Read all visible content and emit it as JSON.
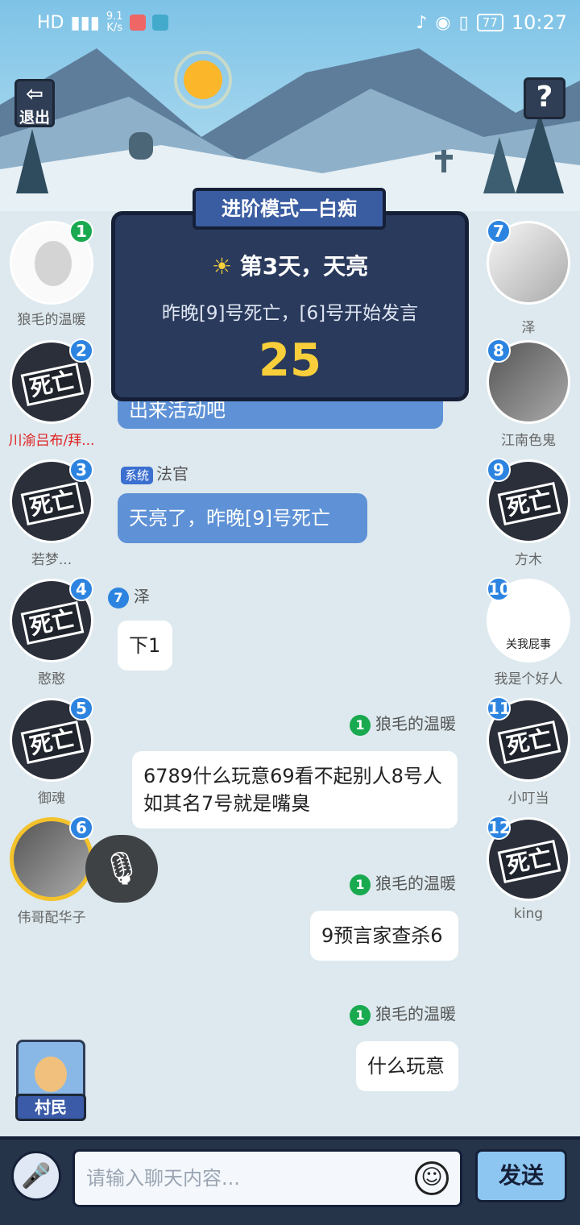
{
  "status_bar": {
    "time": "10:27",
    "battery": "77",
    "signal_label": "HD",
    "net_speed": "9.1",
    "net_unit": "K/s"
  },
  "top": {
    "exit_label": "退出",
    "help_label": "?"
  },
  "banner": {
    "title": "进阶模式—白痴",
    "day": "第3天，天亮",
    "message": "昨晚[9]号死亡，[6]号开始发言",
    "countdown": "25"
  },
  "players_left": [
    {
      "num": "1",
      "name": "狼毛的温暖",
      "dead": false
    },
    {
      "num": "2",
      "name": "川渝吕布/拜...",
      "dead": true
    },
    {
      "num": "3",
      "name": "若梦...",
      "dead": true
    },
    {
      "num": "4",
      "name": "憨憨",
      "dead": true
    },
    {
      "num": "5",
      "name": "御魂",
      "dead": true
    },
    {
      "num": "6",
      "name": "伟哥配华子",
      "dead": false
    }
  ],
  "players_right": [
    {
      "num": "7",
      "name": "泽",
      "dead": false
    },
    {
      "num": "8",
      "name": "江南色鬼",
      "dead": false
    },
    {
      "num": "9",
      "name": "方木",
      "dead": true
    },
    {
      "num": "10",
      "name": "我是个好人",
      "dead": false
    },
    {
      "num": "11",
      "name": "小叮当",
      "dead": true
    },
    {
      "num": "12",
      "name": "king",
      "dead": true
    }
  ],
  "dead_label": "死亡",
  "avatar10_text": "关我屁事",
  "messages": {
    "partial": "出来活动吧",
    "sys_tag": "系统",
    "sys_sender": "法官",
    "sys_text": "天亮了，昨晚[9]号死亡",
    "m1_num": "7",
    "m1_sender": "泽",
    "m1_text": "下1",
    "m2_num": "1",
    "m2_sender": "狼毛的温暖",
    "m2_text": "6789什么玩意69看不起别人8号人如其名7号就是嘴臭",
    "m3_num": "1",
    "m3_sender": "狼毛的温暖",
    "m3_text": "9预言家查杀6",
    "m4_num": "1",
    "m4_sender": "狼毛的温暖",
    "m4_text": "什么玩意"
  },
  "role": {
    "label": "村民"
  },
  "input": {
    "placeholder": "请输入聊天内容...",
    "send_label": "发送"
  }
}
